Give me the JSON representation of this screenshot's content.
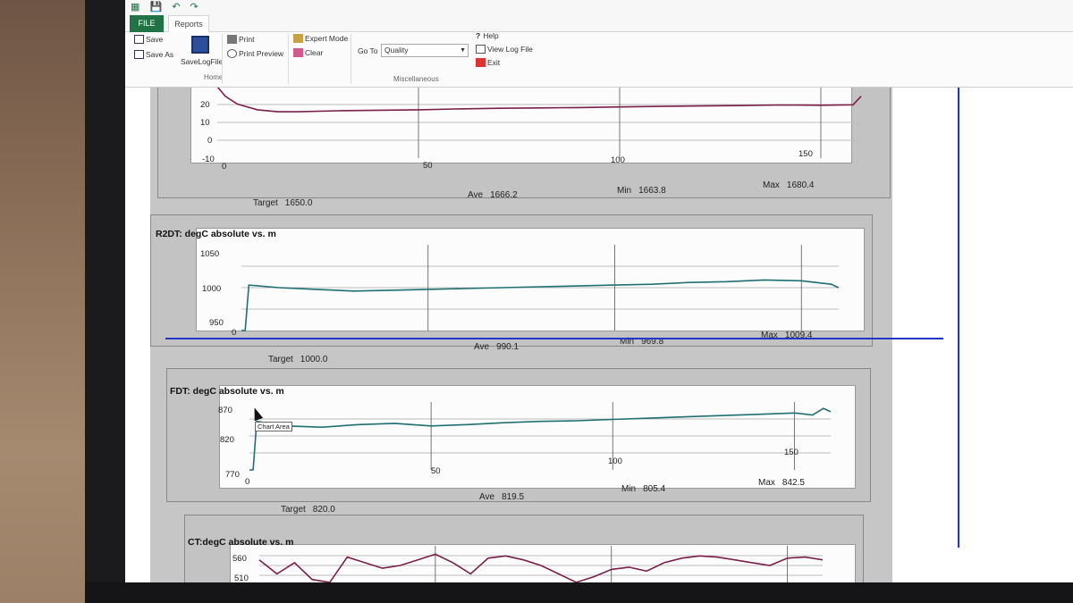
{
  "app": {
    "quick_access": [
      "X",
      "save",
      "undo",
      "redo"
    ]
  },
  "tabs": [
    {
      "label": "FILE",
      "active": false
    },
    {
      "label": "Reports",
      "active": true
    }
  ],
  "ribbon": {
    "home": {
      "save": "Save",
      "save_as": "Save As",
      "save_log": "SaveLogFile",
      "group": "Home"
    },
    "print": {
      "print": "Print",
      "print_preview": "Print Preview"
    },
    "mode": {
      "expert": "Expert Mode",
      "clear": "Clear"
    },
    "goto": {
      "label": "Go To",
      "value": "Quality"
    },
    "misc": {
      "help": "Help",
      "view_log": "View Log File",
      "exit": "Exit",
      "group": "Miscellaneous"
    }
  },
  "colors": {
    "accent": "#217346",
    "series_maroon": "#7a1f4a",
    "series_teal": "#1f6f73",
    "blue_line": "#2235c8"
  },
  "tooltip": "Chart Area",
  "charts": [
    {
      "title": "",
      "yticks": [
        "20",
        "10",
        "0",
        "-10"
      ],
      "xticks": [
        "0",
        "50",
        "100",
        "150"
      ],
      "stats": {
        "target_label": "Target",
        "target": "1650.0",
        "ave_label": "Ave",
        "ave": "1666.2",
        "min_label": "Min",
        "min": "1663.8",
        "max_label": "Max",
        "max": "1680.4"
      }
    },
    {
      "title": "R2DT: degC absolute vs. m",
      "yticks": [
        "1050",
        "1000",
        "950"
      ],
      "xticks": [
        "0"
      ],
      "stats": {
        "target_label": "Target",
        "target": "1000.0",
        "ave_label": "Ave",
        "ave": "990.1",
        "min_label": "Min",
        "min": "969.8",
        "max_label": "Max",
        "max": "1009.4"
      }
    },
    {
      "title": "FDT: degC absolute vs. m",
      "yticks": [
        "870",
        "820",
        "770"
      ],
      "xticks": [
        "0",
        "50",
        "100",
        "150"
      ],
      "stats": {
        "target_label": "Target",
        "target": "820.0",
        "ave_label": "Ave",
        "ave": "819.5",
        "min_label": "Min",
        "min": "805.4",
        "max_label": "Max",
        "max": "842.5"
      }
    },
    {
      "title": "CT:degC absolute vs. m",
      "yticks": [
        "560",
        "510"
      ],
      "xticks": []
    }
  ],
  "chart_data": [
    {
      "type": "line",
      "title": "",
      "x": [
        0,
        2,
        5,
        10,
        15,
        20,
        30,
        40,
        50,
        60,
        70,
        80,
        90,
        100,
        110,
        120,
        130,
        140,
        150,
        158,
        160
      ],
      "series": [
        {
          "name": "",
          "values": [
            27,
            22,
            18,
            15,
            14,
            14,
            14.5,
            14.8,
            15,
            15.5,
            15.8,
            16,
            16.2,
            16.5,
            16.8,
            17,
            17.2,
            17.5,
            17.4,
            17.6,
            22
          ]
        }
      ],
      "xlim": [
        0,
        160
      ],
      "ylim": [
        -10,
        27
      ],
      "grid": true
    },
    {
      "type": "line",
      "title": "R2DT: degC absolute vs. m",
      "x": [
        0,
        1,
        2,
        10,
        20,
        30,
        40,
        50,
        60,
        70,
        80,
        90,
        100,
        110,
        120,
        130,
        140,
        150,
        158,
        160
      ],
      "series": [
        {
          "name": "",
          "values": [
            950,
            950,
            1003,
            1000,
            998,
            996,
            997,
            998,
            999,
            1000,
            1001,
            1002,
            1003,
            1004,
            1006,
            1007,
            1009,
            1008,
            1004,
            1000
          ]
        }
      ],
      "xlim": [
        0,
        160
      ],
      "ylim": [
        950,
        1050
      ],
      "grid": true
    },
    {
      "type": "line",
      "title": "FDT: degC absolute vs. m",
      "x": [
        0,
        1,
        2,
        10,
        20,
        30,
        40,
        50,
        60,
        70,
        80,
        90,
        100,
        110,
        120,
        130,
        140,
        150,
        155,
        158,
        160
      ],
      "series": [
        {
          "name": "",
          "values": [
            770,
            770,
            845,
            838,
            836,
            840,
            842,
            838,
            840,
            843,
            845,
            846,
            848,
            850,
            852,
            854,
            856,
            858,
            855,
            865,
            860
          ]
        }
      ],
      "xlim": [
        0,
        160
      ],
      "ylim": [
        770,
        875
      ],
      "grid": true
    },
    {
      "type": "line",
      "title": "CT:degC absolute vs. m",
      "x": [
        0,
        5,
        10,
        15,
        20,
        25,
        30,
        35,
        40,
        45,
        50,
        55,
        60,
        65,
        70,
        75,
        80,
        85,
        90,
        95,
        100,
        105,
        110,
        115,
        120,
        125,
        130,
        135,
        140,
        145,
        150,
        155,
        160
      ],
      "series": [
        {
          "name": "",
          "values": [
            545,
            520,
            540,
            510,
            505,
            550,
            540,
            530,
            535,
            545,
            555,
            540,
            520,
            548,
            552,
            545,
            535,
            520,
            505,
            515,
            528,
            532,
            525,
            540,
            548,
            552,
            550,
            545,
            540,
            535,
            548,
            550,
            545
          ]
        }
      ],
      "xlim": [
        0,
        160
      ],
      "ylim": [
        500,
        570
      ],
      "grid": true
    }
  ]
}
